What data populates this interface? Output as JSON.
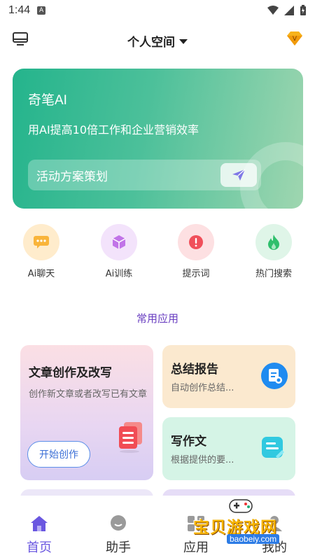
{
  "status_bar": {
    "time": "1:44",
    "app_badge": "A"
  },
  "header": {
    "space_title": "个人空间"
  },
  "hero": {
    "title": "奇笔AI",
    "slogan": "用AI提高10倍工作和企业营销效率",
    "prompt_value": "活动方案策划"
  },
  "quick_actions": [
    {
      "label": "Ai聊天",
      "icon": "chat-bubble-icon",
      "color": "#ffeccc"
    },
    {
      "label": "Ai训练",
      "icon": "cube-icon",
      "color": "#f3e3fb"
    },
    {
      "label": "提示词",
      "icon": "alert-icon",
      "color": "#fde0e2"
    },
    {
      "label": "热门搜索",
      "icon": "flame-icon",
      "color": "#dff5e8"
    }
  ],
  "section_title": "常用应用",
  "cards": {
    "article": {
      "title": "文章创作及改写",
      "desc": "创作新文章或者改写已有文章",
      "button": "开始创作"
    },
    "summary": {
      "title": "总结报告",
      "desc": "自动创作总结..."
    },
    "essay": {
      "title": "写作文",
      "desc": "根据提供的要..."
    }
  },
  "nav": [
    {
      "label": "首页",
      "icon": "home-icon",
      "active": true
    },
    {
      "label": "助手",
      "icon": "assistant-icon",
      "active": false
    },
    {
      "label": "应用",
      "icon": "apps-icon",
      "active": false
    },
    {
      "label": "我的",
      "icon": "profile-icon",
      "active": false
    }
  ],
  "watermark": {
    "text": "宝贝游戏网",
    "url": "baobeiy.com"
  },
  "colors": {
    "accent": "#6a57e0",
    "hero_start": "#24b48c",
    "hero_end": "#9fd6b0"
  }
}
